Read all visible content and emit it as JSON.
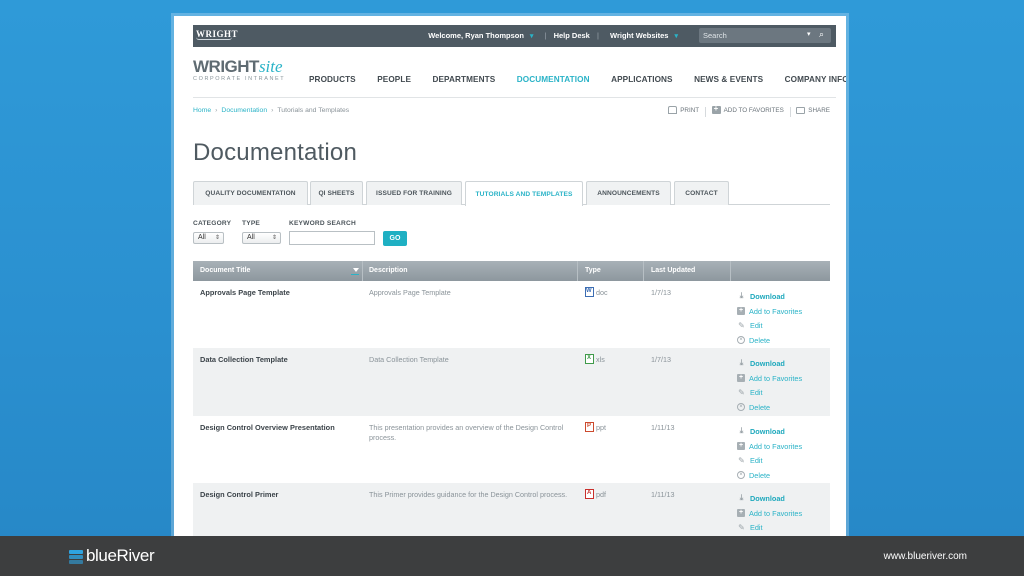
{
  "topbar": {
    "logo": "WRIGHT",
    "welcome": "Welcome, Ryan Thompson",
    "help_desk": "Help Desk",
    "websites": "Wright Websites",
    "search_placeholder": "Search"
  },
  "brand": {
    "wright": "WRIGHT",
    "site": "site",
    "subtitle": "CORPORATE INTRANET"
  },
  "nav": {
    "items": [
      {
        "label": "PRODUCTS"
      },
      {
        "label": "PEOPLE"
      },
      {
        "label": "DEPARTMENTS"
      },
      {
        "label": "DOCUMENTATION",
        "active": true
      },
      {
        "label": "APPLICATIONS"
      },
      {
        "label": "NEWS & EVENTS"
      },
      {
        "label": "COMPANY INFORMATION"
      }
    ]
  },
  "breadcrumb": {
    "home": "Home",
    "documentation": "Documentation",
    "current": "Tutorials and Templates"
  },
  "tools": {
    "print": "PRINT",
    "favorites": "ADD TO FAVORITES",
    "share": "SHARE"
  },
  "page_title": "Documentation",
  "tabs": [
    {
      "label": "QUALITY DOCUMENTATION"
    },
    {
      "label": "QI SHEETS"
    },
    {
      "label": "ISSUED FOR TRAINING"
    },
    {
      "label": "TUTORIALS AND TEMPLATES",
      "active": true
    },
    {
      "label": "ANNOUNCEMENTS"
    },
    {
      "label": "CONTACT"
    }
  ],
  "filters": {
    "category_label": "CATEGORY",
    "category_value": "All",
    "type_label": "TYPE",
    "type_value": "All",
    "keyword_label": "KEYWORD SEARCH",
    "keyword_value": "",
    "go_label": "GO"
  },
  "table": {
    "columns": [
      "Document Title",
      "Description",
      "Type",
      "Last Updated"
    ],
    "actions": {
      "download": "Download",
      "favorite": "Add to Favorites",
      "edit": "Edit",
      "delete": "Delete"
    },
    "rows": [
      {
        "title": "Approvals Page Template",
        "description": "Approvals Page Template",
        "type": "doc",
        "updated": "1/7/13"
      },
      {
        "title": "Data Collection Template",
        "description": "Data Collection Template",
        "type": "xls",
        "updated": "1/7/13"
      },
      {
        "title": "Design Control Overview Presentation",
        "description": "This presentation provides an overview of the Design Control process.",
        "type": "ppt",
        "updated": "1/11/13"
      },
      {
        "title": "Design Control Primer",
        "description": "This Primer provides guidance for the Design Control process.",
        "type": "pdf",
        "updated": "1/11/13"
      }
    ]
  },
  "footer": {
    "brand": "blueRiver",
    "url": "www.blueriver.com"
  },
  "colors": {
    "accent": "#2ab3c7",
    "topbar": "#4e5a63",
    "background": "#2f9ad8",
    "footer": "#3d3e3f"
  }
}
